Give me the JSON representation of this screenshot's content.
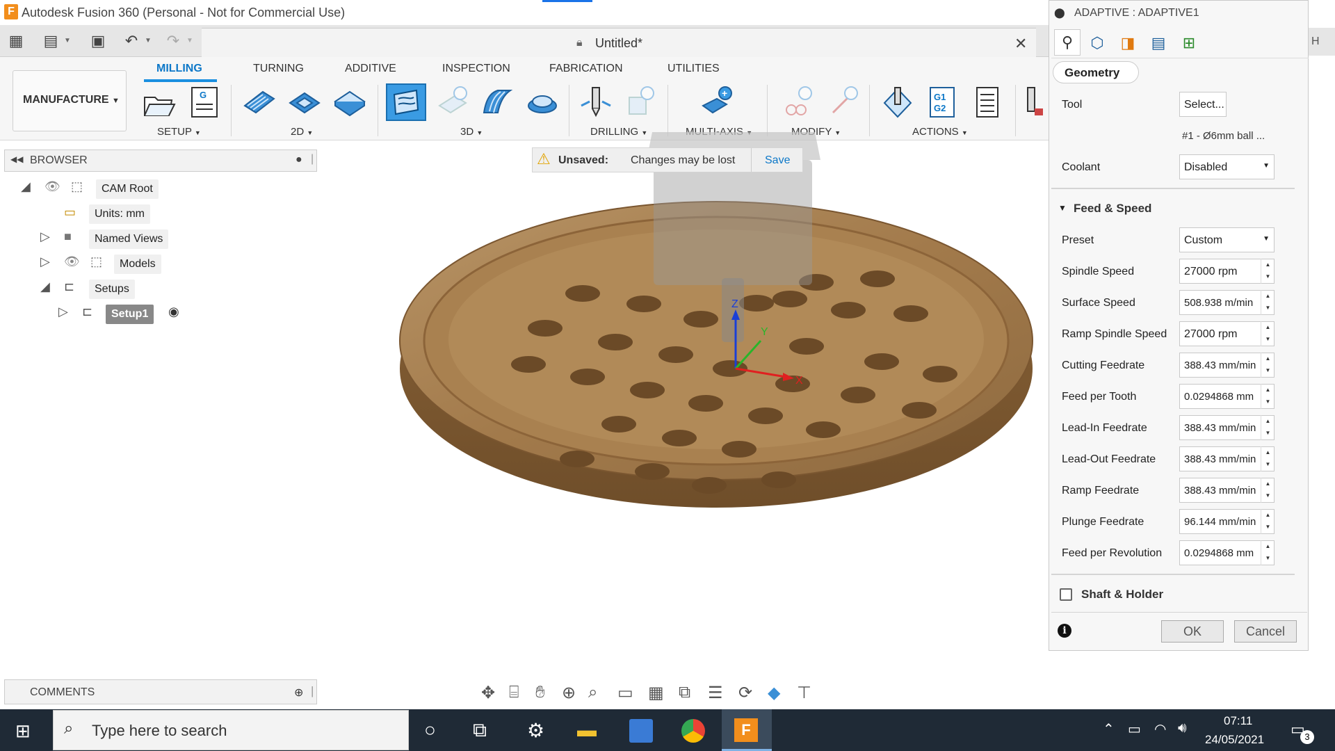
{
  "window": {
    "title": "Autodesk Fusion 360 (Personal - Not for Commercial Use)",
    "logo_letter": "F"
  },
  "document": {
    "title": "Untitled*"
  },
  "workspace": {
    "label": "MANUFACTURE"
  },
  "ribbon": {
    "tabs": [
      "MILLING",
      "TURNING",
      "ADDITIVE",
      "INSPECTION",
      "FABRICATION",
      "UTILITIES"
    ],
    "groups": [
      "SETUP",
      "2D",
      "3D",
      "DRILLING",
      "MULTI-AXIS",
      "MODIFY",
      "ACTIONS"
    ]
  },
  "browser": {
    "title": "BROWSER",
    "items": [
      "CAM Root",
      "Units: mm",
      "Named Views",
      "Models",
      "Setups",
      "Setup1"
    ]
  },
  "notice": {
    "label": "Unsaved:",
    "message": "Changes may be lost",
    "save": "Save"
  },
  "viewport": {
    "axis_z": "Z",
    "axis_y": "Y",
    "axis_x": "X"
  },
  "panel": {
    "title": "ADAPTIVE : ADAPTIVE1",
    "section_tab": "Geometry",
    "tool_label": "Tool",
    "tool_button": "Select...",
    "tool_name": "#1 - Ø6mm ball ...",
    "coolant_label": "Coolant",
    "coolant_value": "Disabled",
    "feed_section": "Feed & Speed",
    "preset_label": "Preset",
    "preset_value": "Custom",
    "fields": [
      {
        "label": "Spindle Speed",
        "value": "27000 rpm"
      },
      {
        "label": "Surface Speed",
        "value": "508.938 m/min"
      },
      {
        "label": "Ramp Spindle Speed",
        "value": "27000 rpm"
      },
      {
        "label": "Cutting Feedrate",
        "value": "388.43 mm/min"
      },
      {
        "label": "Feed per Tooth",
        "value": "0.0294868 mm"
      },
      {
        "label": "Lead-In Feedrate",
        "value": "388.43 mm/min"
      },
      {
        "label": "Lead-Out Feedrate",
        "value": "388.43 mm/min"
      },
      {
        "label": "Ramp Feedrate",
        "value": "388.43 mm/min"
      },
      {
        "label": "Plunge Feedrate",
        "value": "96.144 mm/min"
      },
      {
        "label": "Feed per Revolution",
        "value": "0.0294868 mm"
      }
    ],
    "shaft_section": "Shaft & Holder",
    "ok": "OK",
    "cancel": "Cancel",
    "edge_letter": "H"
  },
  "comments": {
    "title": "COMMENTS"
  },
  "taskbar": {
    "search_placeholder": "Type here to search",
    "time": "07:11",
    "date": "24/05/2021",
    "notification_count": "3"
  },
  "colors": {
    "accent": "#0d78c8",
    "wood": "#a47c4c",
    "taskbar": "#1f2a36",
    "fusion_orange": "#f28e1c"
  }
}
